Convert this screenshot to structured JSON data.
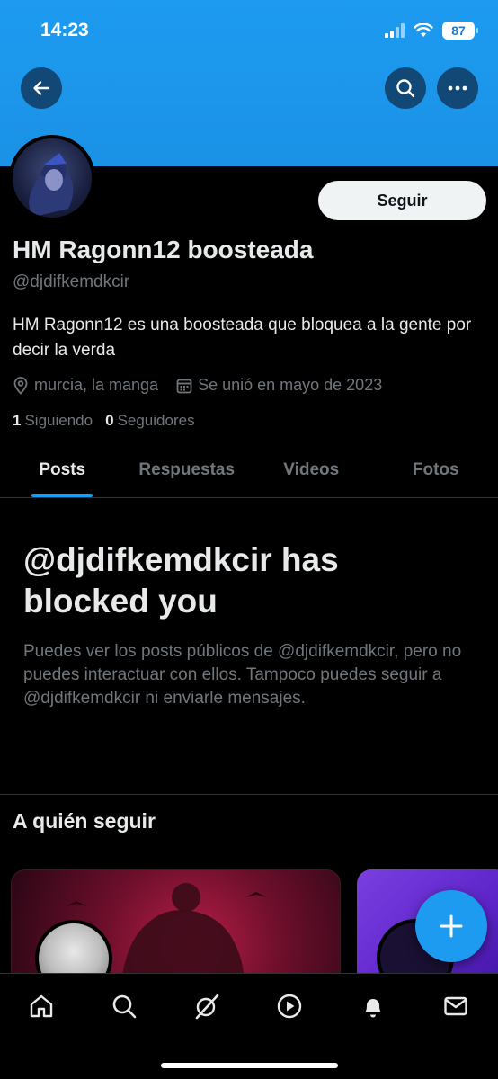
{
  "status_bar": {
    "time": "14:23",
    "battery": "87"
  },
  "header": {
    "back_icon": "arrow-left-icon",
    "search_icon": "search-icon",
    "more_icon": "more-horizontal-icon"
  },
  "profile": {
    "follow_label": "Seguir",
    "display_name": "HM Ragonn12 boosteada",
    "handle": "@djdifkemdkcir",
    "bio": "HM Ragonn12 es una boosteada que bloquea a la gente por decir la verda",
    "location": "murcia, la manga",
    "joined": "Se unió en mayo de 2023",
    "following_count": "1",
    "following_label": "Siguiendo",
    "followers_count": "0",
    "followers_label": "Seguidores"
  },
  "tabs": [
    {
      "label": "Posts",
      "active": true
    },
    {
      "label": "Respuestas",
      "active": false
    },
    {
      "label": "Videos",
      "active": false
    },
    {
      "label": "Fotos",
      "active": false
    }
  ],
  "blocked": {
    "title": "@djdifkemdkcir has blocked you",
    "description": "Puedes ver los posts públicos de @djdifkemdkcir, pero no puedes interactuar con ellos. Tampoco puedes seguir a @djdifkemdkcir ni enviarle mensajes."
  },
  "who_to_follow": {
    "title": "A quién seguir"
  },
  "bottom_nav": [
    "home-icon",
    "search-icon",
    "grok-icon",
    "video-icon",
    "notifications-icon",
    "messages-icon"
  ],
  "colors": {
    "accent": "#1d9bf0",
    "background": "#000000",
    "muted": "#71767b"
  }
}
